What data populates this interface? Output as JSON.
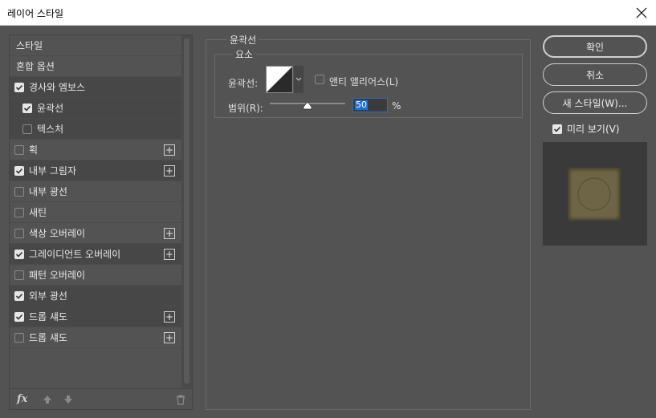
{
  "window": {
    "title": "레이어 스타일"
  },
  "style_list": {
    "header_label": "스타일",
    "blend_label": "혼합 옵션",
    "items": [
      {
        "label": "경사와 엠보스",
        "checked": true,
        "sub": false,
        "plus": false
      },
      {
        "label": "윤곽선",
        "checked": true,
        "sub": true,
        "plus": false,
        "selected": true
      },
      {
        "label": "텍스처",
        "checked": false,
        "sub": true,
        "plus": false
      },
      {
        "label": "획",
        "checked": false,
        "sub": false,
        "plus": true
      },
      {
        "label": "내부 그림자",
        "checked": true,
        "sub": false,
        "plus": true
      },
      {
        "label": "내부 광선",
        "checked": false,
        "sub": false,
        "plus": false
      },
      {
        "label": "새틴",
        "checked": false,
        "sub": false,
        "plus": false
      },
      {
        "label": "색상 오버레이",
        "checked": false,
        "sub": false,
        "plus": true
      },
      {
        "label": "그레이디언트 오버레이",
        "checked": true,
        "sub": false,
        "plus": true
      },
      {
        "label": "패턴 오버레이",
        "checked": false,
        "sub": false,
        "plus": false
      },
      {
        "label": "외부 광선",
        "checked": true,
        "sub": false,
        "plus": false
      },
      {
        "label": "드롭 섀도",
        "checked": true,
        "sub": false,
        "plus": true
      },
      {
        "label": "드롭 섀도",
        "checked": false,
        "sub": false,
        "plus": true
      }
    ],
    "plus_symbol": "+",
    "fx_label": "fx"
  },
  "panel": {
    "title": "윤곽선",
    "group_title": "요소",
    "contour_label": "윤곽선:",
    "anti_alias_label": "앤티 앨리어스(L)",
    "range_label": "범위(R):",
    "range_value": "50",
    "range_percent": 50,
    "range_unit": "%"
  },
  "buttons": {
    "ok": "확인",
    "cancel": "취소",
    "new_style": "새 스타일(W)...",
    "preview_label": "미리 보기(V)"
  },
  "colors": {
    "dialog_bg": "#535353",
    "preview_swatch": "#6e6546",
    "selection": "#1e6fd8"
  }
}
